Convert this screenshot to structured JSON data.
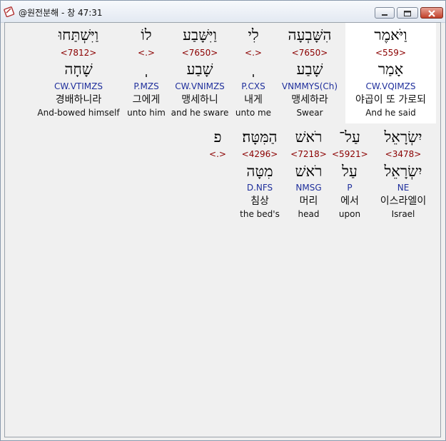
{
  "window": {
    "title": "@원전분해 - 창 47:31"
  },
  "row1": [
    {
      "heb": "וַיֹּאמֶר",
      "strong": "<559>",
      "root": "אָמַר",
      "morph": "CW.VQIMZS",
      "kor": "야곱이 또 가로되",
      "eng": "And he said"
    },
    {
      "heb": "הִשָּׁבְעָה",
      "strong": "<7650>",
      "root": "שָׁבַע",
      "morph": "VNMMYS(Ch)",
      "kor": "맹세하라",
      "eng": "Swear"
    },
    {
      "heb": "לִי",
      "strong": "<.>",
      "root": "",
      "morph": "P.CXS",
      "kor": "내게",
      "eng": "unto me"
    },
    {
      "heb": "וַיִּשָּׁבַע",
      "strong": "<7650>",
      "root": "שָׁבַע",
      "morph": "CW.VNIMZS",
      "kor": "맹세하니",
      "eng": "and he sware"
    },
    {
      "heb": "לוֹ",
      "strong": "<.>",
      "root": "",
      "morph": "P.MZS",
      "kor": "그에게",
      "eng": "unto him"
    },
    {
      "heb": "וַיִּשְׁתַּחוּ",
      "strong": "<7812>",
      "root": "שָׁחָה",
      "morph": "CW.VTIMZS",
      "kor": "경배하니라",
      "eng": "And-bowed himself"
    }
  ],
  "row2": [
    {
      "heb": "יִשְׂרָאֵל",
      "strong": "<3478>",
      "root": "יִשְׂרָאֵל",
      "morph": "NE",
      "kor": "이스라엘이",
      "eng": "Israel"
    },
    {
      "heb": "עַל־",
      "strong": "<5921>",
      "root": "עַל",
      "morph": "P",
      "kor": "에서",
      "eng": "upon"
    },
    {
      "heb": "רֹאשׁ",
      "strong": "<7218>",
      "root": "רֹאשׁ",
      "morph": "NMSG",
      "kor": "머리",
      "eng": "head"
    },
    {
      "heb": "הַמִּטָּה׃",
      "strong": "<4296>",
      "root": "מִטָּה",
      "morph": "D.NFS",
      "kor": "침상",
      "eng": "the bed's"
    },
    {
      "heb": "פ",
      "strong": "<.>",
      "root": "",
      "morph": "",
      "kor": "",
      "eng": ""
    }
  ]
}
